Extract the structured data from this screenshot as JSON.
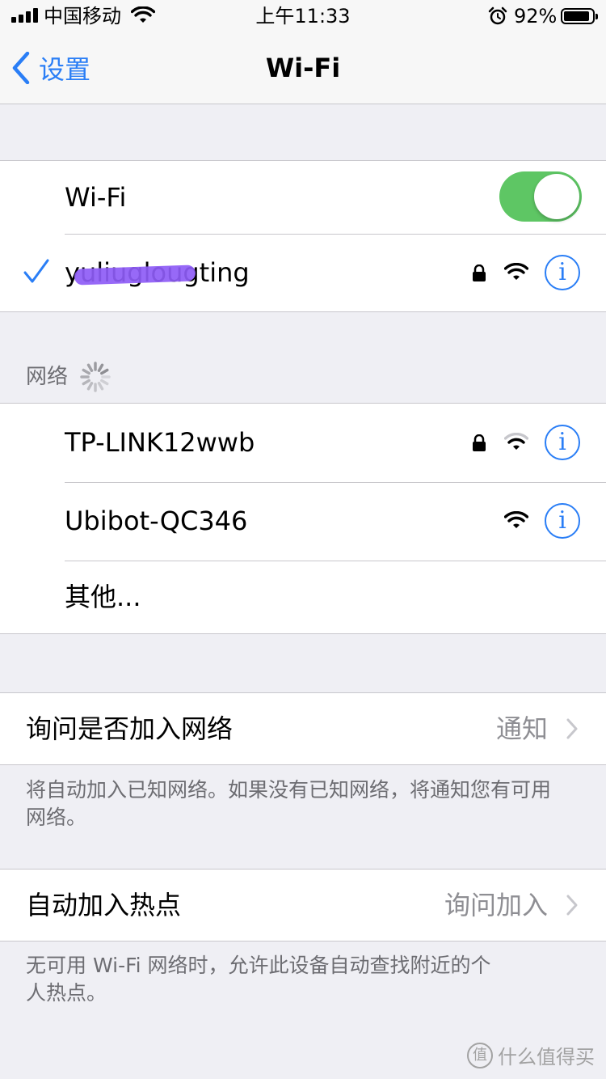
{
  "status_bar": {
    "carrier": "中国移动",
    "time": "上午11:33",
    "battery_percent": "92%",
    "battery_level": 0.92,
    "icons": [
      "signal-icon",
      "wifi-icon",
      "alarm-icon",
      "battery-icon"
    ]
  },
  "nav": {
    "back_label": "设置",
    "title": "Wi-Fi"
  },
  "wifi_toggle": {
    "label": "Wi-Fi",
    "on": true
  },
  "connected": {
    "name": "yuliuglougting",
    "secured": true
  },
  "networks_header": "网络",
  "networks": [
    {
      "name": "TP-LINK12wwb",
      "secured": true
    },
    {
      "name": "Ubibot-QC346",
      "secured": false
    }
  ],
  "other_label": "其他...",
  "ask_join": {
    "label": "询问是否加入网络",
    "value": "通知",
    "footer": "将自动加入已知网络。如果没有已知网络，将通知您有可用网络。"
  },
  "auto_hotspot": {
    "label": "自动加入热点",
    "value": "询问加入",
    "footer": "无可用 Wi-Fi 网络时，允许此设备自动查找附近的个人热点。"
  },
  "watermark": "什么值得买",
  "colors": {
    "accent": "#2a7ef6",
    "toggle_on": "#5ec664",
    "background": "#efeff4",
    "secondary_text": "#8e8e93"
  }
}
